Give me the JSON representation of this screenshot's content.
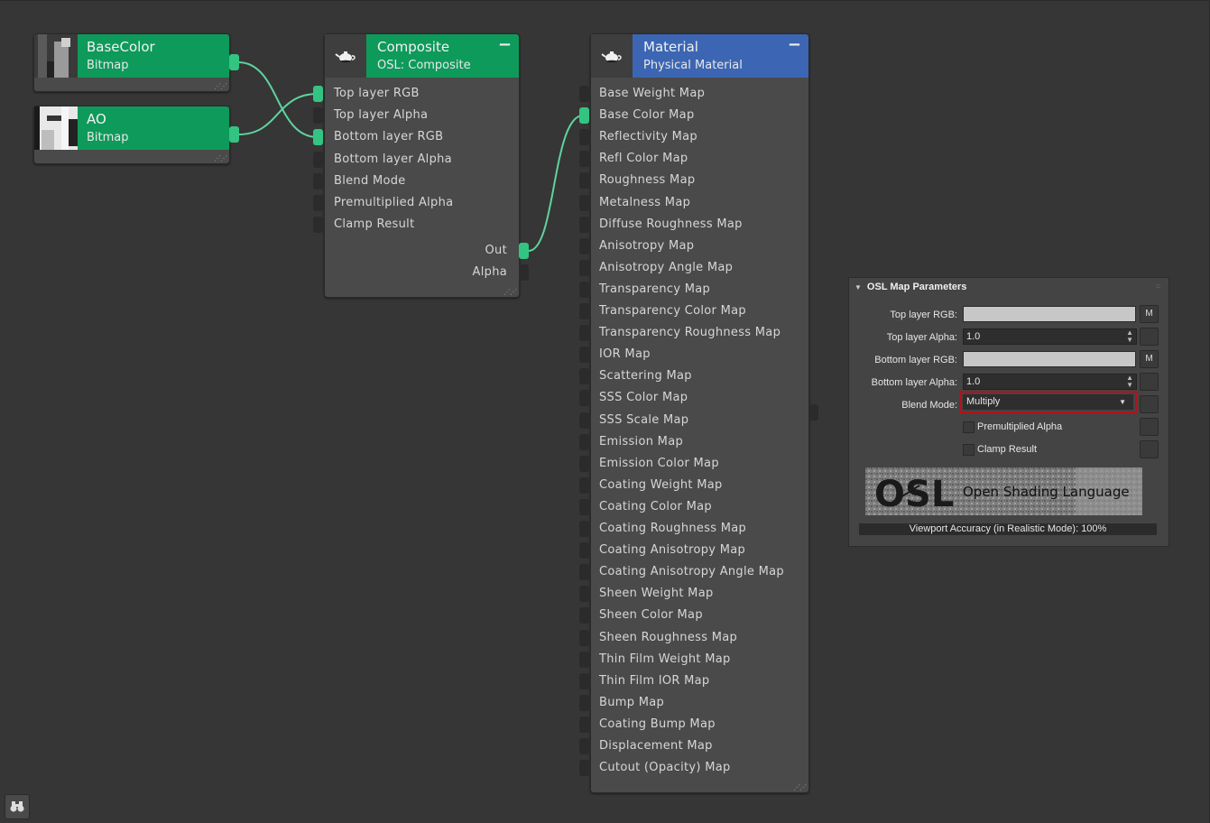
{
  "nodes": {
    "basecolor": {
      "title": "BaseColor",
      "subtitle": "Bitmap"
    },
    "ao": {
      "title": "AO",
      "subtitle": "Bitmap"
    },
    "composite": {
      "title": "Composite",
      "subtitle": "OSL: Composite",
      "collapse": "−",
      "inputs": [
        "Top layer RGB",
        "Top layer Alpha",
        "Bottom layer RGB",
        "Bottom layer Alpha",
        "Blend Mode",
        "Premultiplied Alpha",
        "Clamp Result"
      ],
      "outputs": [
        "Out",
        "Alpha"
      ]
    },
    "material": {
      "title": "Material",
      "subtitle": "Physical Material",
      "collapse": "−",
      "inputs": [
        "Base Weight Map",
        "Base Color Map",
        "Reflectivity Map",
        "Refl Color Map",
        "Roughness Map",
        "Metalness Map",
        "Diffuse Roughness Map",
        "Anisotropy Map",
        "Anisotropy Angle Map",
        "Transparency Map",
        "Transparency Color Map",
        "Transparency Roughness Map",
        "IOR Map",
        "Scattering Map",
        "SSS Color Map",
        "SSS Scale Map",
        "Emission Map",
        "Emission Color Map",
        "Coating Weight Map",
        "Coating Color Map",
        "Coating Roughness Map",
        "Coating Anisotropy Map",
        "Coating Anisotropy Angle Map",
        "Sheen Weight Map",
        "Sheen Color Map",
        "Sheen Roughness Map",
        "Thin Film Weight Map",
        "Thin Film IOR Map",
        "Bump Map",
        "Coating Bump Map",
        "Displacement Map",
        "Cutout (Opacity) Map"
      ]
    }
  },
  "panel": {
    "title": "OSL Map Parameters",
    "top_rgb_label": "Top layer RGB:",
    "top_alpha_label": "Top layer Alpha:",
    "top_alpha_value": "1.0",
    "bottom_rgb_label": "Bottom layer RGB:",
    "bottom_alpha_label": "Bottom layer Alpha:",
    "bottom_alpha_value": "1.0",
    "blend_mode_label": "Blend Mode:",
    "blend_mode_value": "Multiply",
    "premult_label": "Premultiplied Alpha",
    "clamp_label": "Clamp Result",
    "map_button": "M",
    "logo_text": "OSL",
    "logo_caption": "Open Shading Language",
    "footer": "Viewport Accuracy (in Realistic Mode): 100%"
  },
  "colors": {
    "bitmap_header": "#0e9a5a",
    "material_header": "#3c66b3",
    "socket_connected": "#33c482",
    "wire": "#5fd3a0",
    "highlight": "#b3121a"
  }
}
